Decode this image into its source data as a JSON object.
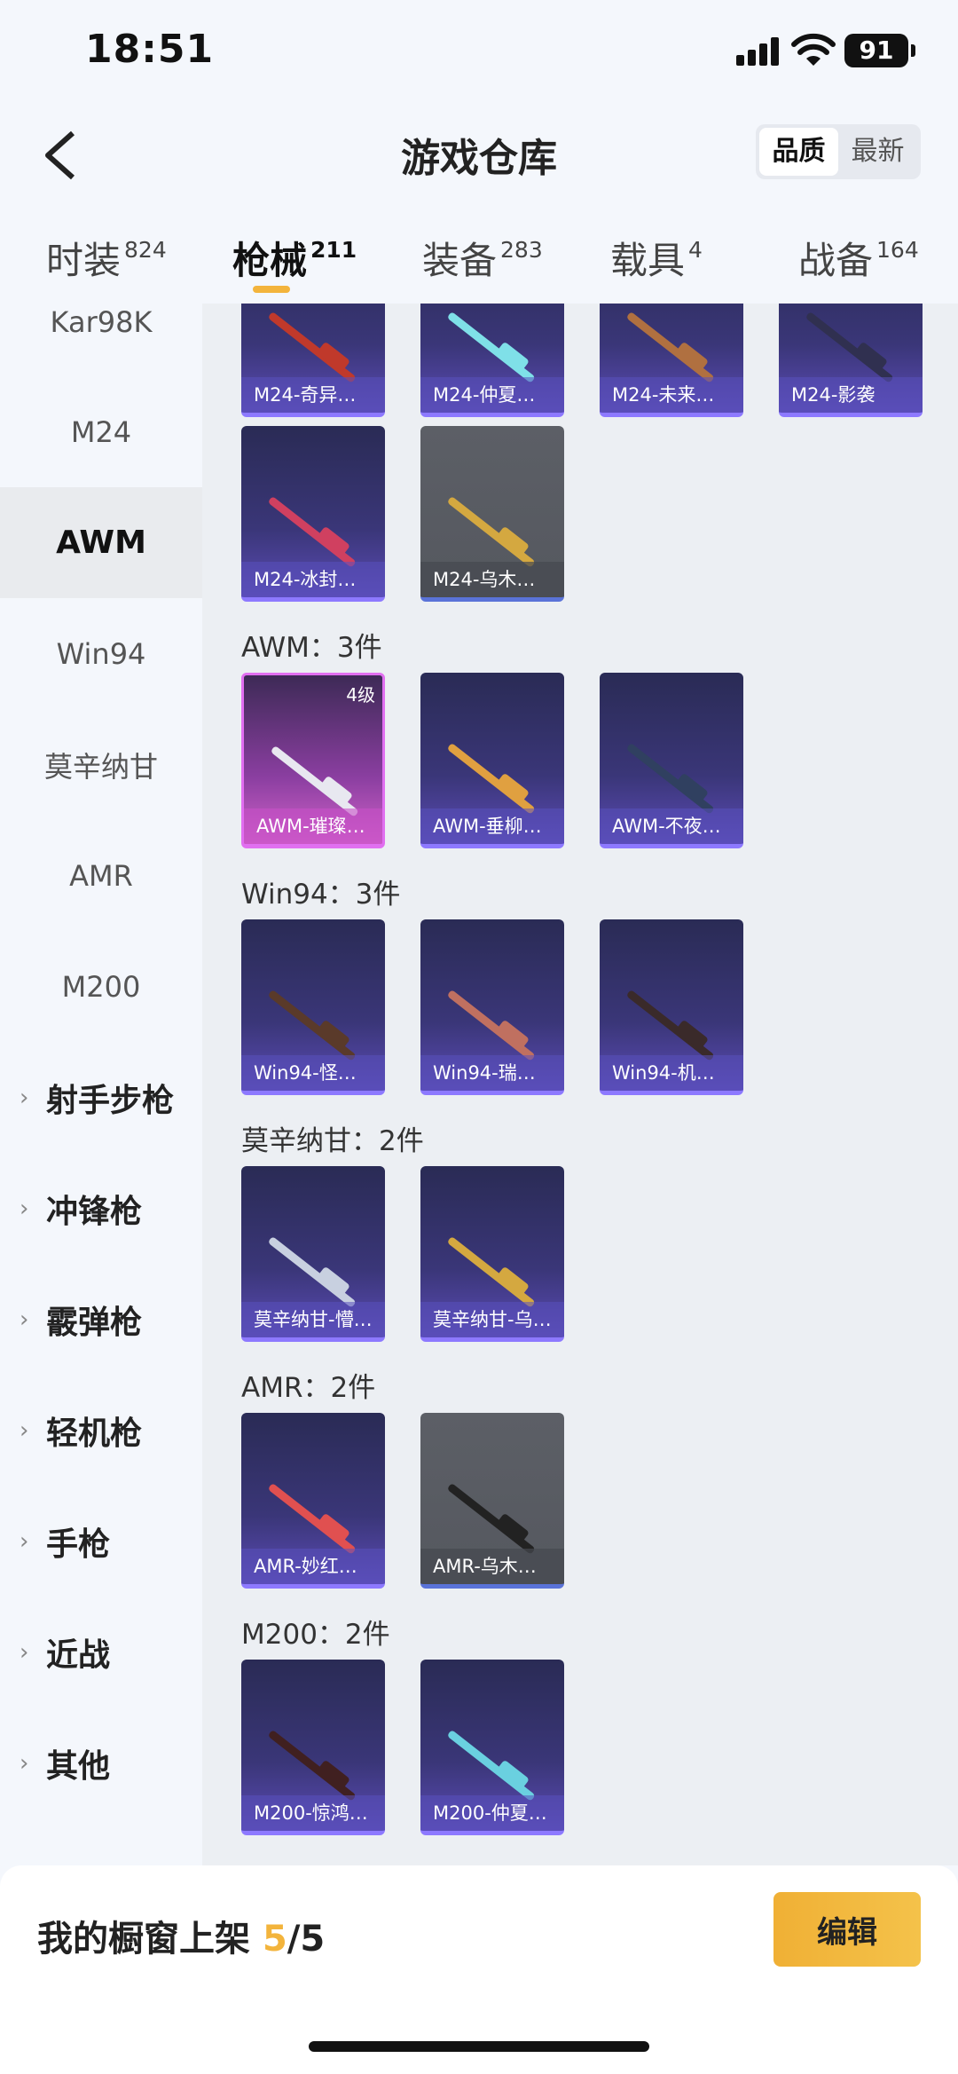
{
  "status": {
    "time": "18:51",
    "battery": "91"
  },
  "header": {
    "title": "游戏仓库",
    "sort_options": [
      "品质",
      "最新"
    ],
    "sort_active": "品质"
  },
  "tabs": [
    {
      "label": "时装",
      "count": "824"
    },
    {
      "label": "枪械",
      "count": "211"
    },
    {
      "label": "装备",
      "count": "283"
    },
    {
      "label": "载具",
      "count": "4"
    },
    {
      "label": "战备",
      "count": "164"
    }
  ],
  "active_tab": "枪械",
  "sidebar": {
    "items": [
      "Kar98K",
      "M24",
      "AWM",
      "Win94",
      "莫辛纳甘",
      "AMR",
      "M200"
    ],
    "active_item": "AWM",
    "groups": [
      "射手步枪",
      "冲锋枪",
      "霰弹枪",
      "轻机枪",
      "手枪",
      "近战",
      "其他"
    ]
  },
  "sections": [
    {
      "id": "m24",
      "title": "",
      "items": [
        {
          "name": "M24-奇异…",
          "style": "purple",
          "accent": "#c0392b"
        },
        {
          "name": "M24-仲夏…",
          "style": "purple",
          "accent": "#7fe0e8"
        },
        {
          "name": "M24-未来…",
          "style": "purple",
          "accent": "#b07040"
        },
        {
          "name": "M24-影袭",
          "style": "purple",
          "accent": "#303050"
        },
        {
          "name": "M24-冰封…",
          "style": "purple",
          "accent": "#d04060"
        },
        {
          "name": "M24-乌木…",
          "style": "grey",
          "accent": "#d4a840"
        }
      ]
    },
    {
      "id": "awm",
      "title": "AWM：3件",
      "items": [
        {
          "name": "AWM-璀璨…",
          "style": "pink",
          "accent": "#e8e8f0",
          "level": "4级"
        },
        {
          "name": "AWM-垂柳…",
          "style": "purple",
          "accent": "#e0a040"
        },
        {
          "name": "AWM-不夜…",
          "style": "purple",
          "accent": "#304060"
        }
      ]
    },
    {
      "id": "win94",
      "title": "Win94：3件",
      "items": [
        {
          "name": "Win94-怪…",
          "style": "purple",
          "accent": "#5a3a2a"
        },
        {
          "name": "Win94-瑞…",
          "style": "purple",
          "accent": "#c07060"
        },
        {
          "name": "Win94-机…",
          "style": "purple",
          "accent": "#3a2a2a"
        }
      ]
    },
    {
      "id": "mosin",
      "title": "莫辛纳甘：2件",
      "items": [
        {
          "name": "莫辛纳甘-懵…",
          "style": "purple",
          "accent": "#c8d0e0"
        },
        {
          "name": "莫辛纳甘-乌…",
          "style": "purple",
          "accent": "#d4a840"
        }
      ]
    },
    {
      "id": "amr",
      "title": "AMR：2件",
      "items": [
        {
          "name": "AMR-妙红…",
          "style": "purple",
          "accent": "#e05050"
        },
        {
          "name": "AMR-乌木…",
          "style": "grey",
          "accent": "#222222"
        }
      ]
    },
    {
      "id": "m200",
      "title": "M200：2件",
      "items": [
        {
          "name": "M200-惊鸿…",
          "style": "purple",
          "accent": "#402020"
        },
        {
          "name": "M200-仲夏…",
          "style": "purple",
          "accent": "#6ad0e0"
        }
      ]
    }
  ],
  "bottom": {
    "shelf_label": "我的橱窗上架",
    "shelf_current": "5",
    "shelf_sep": "/",
    "shelf_total": "5",
    "edit_label": "编辑"
  },
  "colors": {
    "accent": "#f3b43c",
    "card_purple": "#3a3678",
    "card_border": "#8d79ff"
  }
}
